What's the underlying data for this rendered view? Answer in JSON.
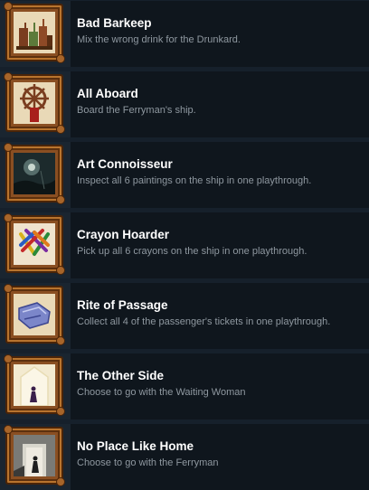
{
  "achievements": [
    {
      "title": "Bad Barkeep",
      "description": "Mix the wrong drink for the Drunkard.",
      "icon": "bottles-icon"
    },
    {
      "title": "All Aboard",
      "description": "Board the Ferryman's ship.",
      "icon": "ship-wheel-icon"
    },
    {
      "title": "Art Connoisseur",
      "description": "Inspect all 6 paintings on the ship in one playthrough.",
      "icon": "painting-icon"
    },
    {
      "title": "Crayon Hoarder",
      "description": "Pick up all 6 crayons on the ship in one playthrough.",
      "icon": "crayons-icon"
    },
    {
      "title": "Rite of Passage",
      "description": "Collect all 4 of the passenger's tickets in one playthrough.",
      "icon": "tickets-icon"
    },
    {
      "title": "The Other Side",
      "description": "Choose to go with the Waiting Woman",
      "icon": "doorway-woman-icon"
    },
    {
      "title": "No Place Like Home",
      "description": "Choose to go with the Ferryman",
      "icon": "doorway-ferryman-icon"
    }
  ]
}
